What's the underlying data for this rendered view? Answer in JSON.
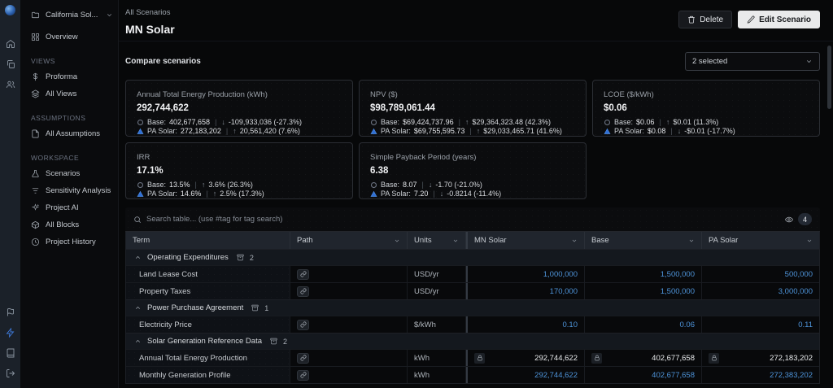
{
  "header": {
    "breadcrumb": "All Scenarios",
    "title": "MN Solar",
    "delete_label": "Delete",
    "edit_label": "Edit Scenario"
  },
  "sidebar": {
    "project": "California Sol...",
    "overview": "Overview",
    "sections": [
      {
        "label": "VIEWS",
        "items": [
          {
            "label": "Proforma"
          },
          {
            "label": "All Views"
          }
        ]
      },
      {
        "label": "ASSUMPTIONS",
        "items": [
          {
            "label": "All Assumptions"
          }
        ]
      },
      {
        "label": "WORKSPACE",
        "items": [
          {
            "label": "Scenarios"
          },
          {
            "label": "Sensitivity Analysis"
          },
          {
            "label": "Project AI"
          },
          {
            "label": "All Blocks"
          },
          {
            "label": "Project History"
          }
        ]
      }
    ]
  },
  "compare": {
    "label": "Compare scenarios",
    "selected": "2 selected"
  },
  "cards": [
    {
      "title": "Annual Total Energy Production (kWh)",
      "value": "292,744,622",
      "base": {
        "label": "Base:",
        "value": "402,677,658",
        "arrow": "↓",
        "delta": "-109,933,036 (-27.3%)"
      },
      "pa": {
        "label": "PA Solar:",
        "value": "272,183,202",
        "arrow": "↑",
        "delta": "20,561,420 (7.6%)"
      }
    },
    {
      "title": "NPV ($)",
      "value": "$98,789,061.44",
      "base": {
        "label": "Base:",
        "value": "$69,424,737.96",
        "arrow": "↑",
        "delta": "$29,364,323.48 (42.3%)"
      },
      "pa": {
        "label": "PA Solar:",
        "value": "$69,755,595.73",
        "arrow": "↑",
        "delta": "$29,033,465.71 (41.6%)"
      }
    },
    {
      "title": "LCOE ($/kWh)",
      "value": "$0.06",
      "base": {
        "label": "Base:",
        "value": "$0.06",
        "arrow": "↑",
        "delta": "$0.01 (11.3%)"
      },
      "pa": {
        "label": "PA Solar:",
        "value": "$0.08",
        "arrow": "↓",
        "delta": "-$0.01 (-17.7%)"
      }
    },
    {
      "title": "IRR",
      "value": "17.1%",
      "base": {
        "label": "Base:",
        "value": "13.5%",
        "arrow": "↑",
        "delta": "3.6% (26.3%)"
      },
      "pa": {
        "label": "PA Solar:",
        "value": "14.6%",
        "arrow": "↑",
        "delta": "2.5% (17.3%)"
      }
    },
    {
      "title": "Simple Payback Period (years)",
      "value": "6.38",
      "base": {
        "label": "Base:",
        "value": "8.07",
        "arrow": "↓",
        "delta": "-1.70 (-21.0%)"
      },
      "pa": {
        "label": "PA Solar:",
        "value": "7.20",
        "arrow": "↓",
        "delta": "-0.8214 (-11.4%)"
      }
    }
  ],
  "search": {
    "placeholder": "Search table... (use #tag for tag search)",
    "count": "4"
  },
  "table": {
    "columns": [
      "Term",
      "Path",
      "Units",
      "MN Solar",
      "Base",
      "PA Solar"
    ],
    "groups": [
      {
        "name": "Operating Expenditures",
        "count": "2",
        "rows": [
          {
            "term": "Land Lease Cost",
            "units": "USD/yr",
            "values": [
              "1,000,000",
              "1,500,000",
              "500,000"
            ]
          },
          {
            "term": "Property Taxes",
            "units": "USD/yr",
            "values": [
              "170,000",
              "1,500,000",
              "3,000,000"
            ]
          }
        ]
      },
      {
        "name": "Power Purchase Agreement",
        "count": "1",
        "rows": [
          {
            "term": "Electricity Price",
            "units": "$/kWh",
            "values": [
              "0.10",
              "0.06",
              "0.11"
            ]
          }
        ]
      },
      {
        "name": "Solar Generation Reference Data",
        "count": "2",
        "rows": [
          {
            "term": "Annual Total Energy Production",
            "units": "kWh",
            "values": [
              "292,744,622",
              "402,677,658",
              "272,183,202"
            ]
          },
          {
            "term": "Monthly Generation Profile",
            "units": "kWh",
            "values": [
              "292,744,622",
              "402,677,658",
              "272,383,202"
            ]
          }
        ]
      }
    ]
  }
}
